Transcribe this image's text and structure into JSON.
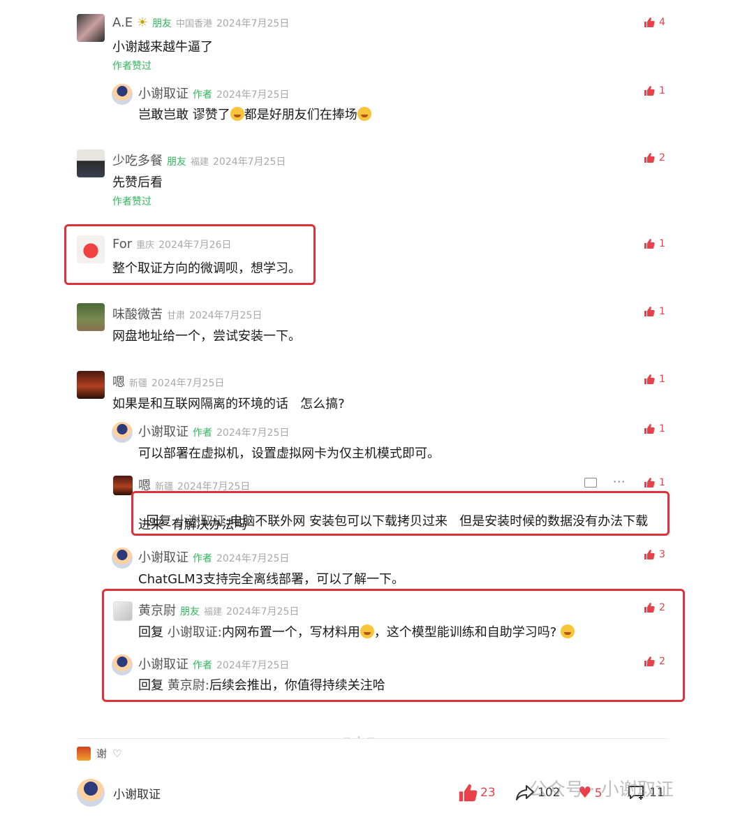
{
  "comments": [
    {
      "name": "A.E",
      "tag": "朋友",
      "location": "中国香港",
      "date": "2024年7月25日",
      "text": "小谢越来越牛逼了",
      "liked_by_author": "作者赞过",
      "likes": "4"
    },
    {
      "name": "小谢取证",
      "tag": "作者",
      "location": "",
      "date": "2024年7月25日",
      "text_a": "岂敢岂敢 谬赞了",
      "text_b": "都是好朋友们在捧场",
      "likes": "1"
    },
    {
      "name": "少吃多餐",
      "tag": "朋友",
      "location": "福建",
      "date": "2024年7月25日",
      "text": "先赞后看",
      "liked_by_author": "作者赞过",
      "likes": "2"
    },
    {
      "name": "For",
      "location": "重庆",
      "date": "2024年7月26日",
      "text": "整个取证方向的微调呗，想学习。",
      "likes": "1"
    },
    {
      "name": "味酸微苦",
      "location": "甘肃",
      "date": "2024年7月25日",
      "text": "网盘地址给一个，尝试安装一下。",
      "likes": "1"
    },
    {
      "name": "嗯",
      "location": "新疆",
      "date": "2024年7月25日",
      "text": "如果是和互联网隔离的环境的话   怎么搞?",
      "likes": "1"
    },
    {
      "name": "小谢取证",
      "tag": "作者",
      "date": "2024年7月25日",
      "text": "可以部署在虚拟机，设置虚拟网卡为仅主机模式即可。",
      "likes": "1"
    },
    {
      "name": "嗯",
      "location": "新疆",
      "date": "2024年7月25日",
      "reply_prefix": "回复",
      "reply_to": "小谢取证:",
      "text_line1": "电脑不联外网 安装包可以下载拷贝过来   但是安装时候的数据没有办法下载",
      "text_line2": "进来  有解决办法吗",
      "likes": "1"
    },
    {
      "name": "小谢取证",
      "tag": "作者",
      "date": "2024年7月25日",
      "text": "ChatGLM3支持完全离线部署，可以了解一下。",
      "likes": "3"
    },
    {
      "name": "黄京尉",
      "tag": "朋友",
      "location": "福建",
      "date": "2024年7月25日",
      "reply_prefix": "回复",
      "reply_to": "小谢取证:",
      "text_a": "内网布置一个，写材料用",
      "text_b": "，这个模型能训练和自助学习吗?",
      "likes": "2"
    },
    {
      "name": "小谢取证",
      "tag": "作者",
      "date": "2024年7月25日",
      "reply_prefix": "回复",
      "reply_to": "黄京尉:",
      "text": "后续会推出，你值得持续关注哈",
      "likes": "2"
    }
  ],
  "footer": {
    "liker_name": "谢",
    "author_name": "小谢取证",
    "like_count": "23",
    "share_count": "102",
    "favorite_count": "5",
    "comment_count": "11",
    "watermark": "公众号 · 小谢取证"
  },
  "colors": {
    "accent_green": "#2fb55a",
    "like_red": "#e8414a",
    "highlight_red": "#e0303b"
  }
}
